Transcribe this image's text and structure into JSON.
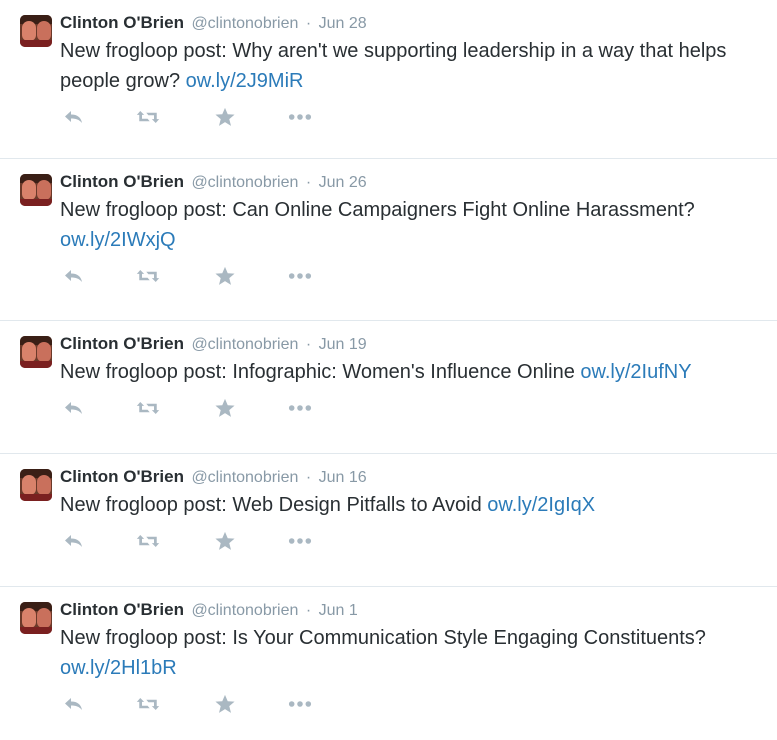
{
  "tweets": [
    {
      "name": "Clinton O'Brien",
      "handle": "@clintonobrien",
      "separator": "·",
      "date": "Jun 28",
      "text": "New frogloop post: Why aren't we supporting leadership in a way that helps people grow?",
      "link": "ow.ly/2J9MiR"
    },
    {
      "name": "Clinton O'Brien",
      "handle": "@clintonobrien",
      "separator": "·",
      "date": "Jun 26",
      "text": "New frogloop post: Can Online Campaigners Fight Online Harassment?",
      "link": "ow.ly/2IWxjQ"
    },
    {
      "name": "Clinton O'Brien",
      "handle": "@clintonobrien",
      "separator": "·",
      "date": "Jun 19",
      "text": "New frogloop post: Infographic: Women's Influence Online",
      "link": "ow.ly/2IufNY"
    },
    {
      "name": "Clinton O'Brien",
      "handle": "@clintonobrien",
      "separator": "·",
      "date": "Jun 16",
      "text": "New frogloop post: Web Design Pitfalls to Avoid",
      "link": "ow.ly/2IgIqX"
    },
    {
      "name": "Clinton O'Brien",
      "handle": "@clintonobrien",
      "separator": "·",
      "date": "Jun 1",
      "text": "New frogloop post: Is Your Communication Style Engaging Constituents?",
      "link": "ow.ly/2Hl1bR"
    }
  ],
  "icons": {
    "reply": "reply-icon",
    "retweet": "retweet-icon",
    "favorite": "star-icon",
    "more": "more-icon"
  },
  "colors": {
    "text": "#292f33",
    "muted": "#8899a6",
    "link": "#2b7bb9",
    "icon": "#aab8c2",
    "divider": "#e1e8ed"
  }
}
